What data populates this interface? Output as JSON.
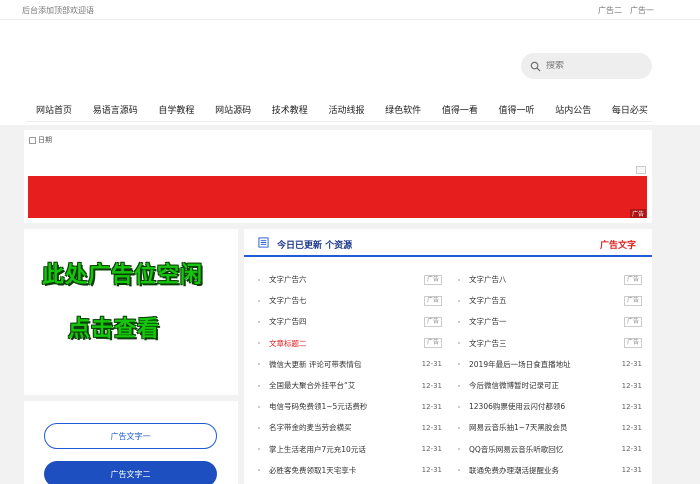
{
  "topbar": {
    "welcome": "后台添加顶部欢迎语",
    "ad_links": [
      "广告二",
      "广告一"
    ]
  },
  "search": {
    "placeholder": "搜索",
    "icon": "search-icon"
  },
  "nav": [
    "网站首页",
    "易语言源码",
    "自学教程",
    "网站源码",
    "技术教程",
    "活动线报",
    "绿色软件",
    "值得一看",
    "值得一听",
    "站内公告",
    "每日必买"
  ],
  "banner": {
    "alt_text": "日期",
    "ad_tag": "广告",
    "bar_color": "#e61e1e"
  },
  "left_ad": {
    "line1": "此处广告位空闲",
    "line2": "点击查看"
  },
  "left_buttons": {
    "outline": "广告文字一",
    "solid": "广告文字二"
  },
  "news": {
    "title": "今日已更新 个资源",
    "ad_text": "广告文字",
    "left": [
      {
        "text": "文字广告六",
        "tag": "广告",
        "red": false
      },
      {
        "text": "文字广告七",
        "tag": "广告",
        "red": false
      },
      {
        "text": "文字广告四",
        "tag": "广告",
        "red": false
      },
      {
        "text": "文章标题二",
        "tag": "广告",
        "red": true
      },
      {
        "text": "微信大更新 评论可带表情包",
        "tag": "12-31",
        "red": false
      },
      {
        "text": "全国最大聚合外挂平台“艾",
        "tag": "12-31",
        "red": false
      },
      {
        "text": "电信号码免费领1~5元话费秒",
        "tag": "12-31",
        "red": false
      },
      {
        "text": "名字带金的麦当劳会横买",
        "tag": "12-31",
        "red": false
      },
      {
        "text": "掌上生活老用户7元充10元话",
        "tag": "12-31",
        "red": false
      },
      {
        "text": "必胜客免费领取1天宅享卡",
        "tag": "12-31",
        "red": false
      }
    ],
    "right": [
      {
        "text": "文字广告八",
        "tag": "广告"
      },
      {
        "text": "文字广告五",
        "tag": "广告"
      },
      {
        "text": "文字广告一",
        "tag": "广告"
      },
      {
        "text": "文字广告三",
        "tag": "广告"
      },
      {
        "text": "2019年最后一场日食直播地址",
        "tag": "12-31"
      },
      {
        "text": "今后微信微博暂时记录可正",
        "tag": "12-31"
      },
      {
        "text": "12306购票使用云闪付都领6",
        "tag": "12-31"
      },
      {
        "text": "网易云音乐抽1~7天黑胶会员",
        "tag": "12-31"
      },
      {
        "text": "QQ音乐网易云音乐听歌回忆",
        "tag": "12-31"
      },
      {
        "text": "联通免费办理潮活提醒业务",
        "tag": "12-31"
      }
    ]
  },
  "colors": {
    "accent": "#1e5bd6",
    "red": "#e02020",
    "green_ad": "#16c60c"
  }
}
